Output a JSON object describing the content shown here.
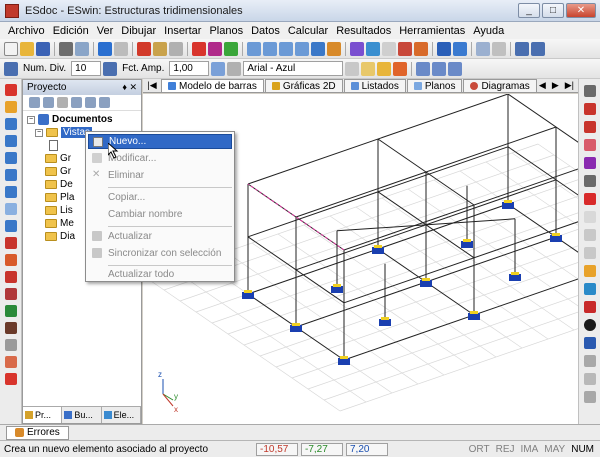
{
  "window": {
    "title": "ESdoc - ESwin: Estructuras tridimensionales",
    "minimize": "_",
    "maximize": "□",
    "close": "✕"
  },
  "menu": [
    "Archivo",
    "Edición",
    "Ver",
    "Dibujar",
    "Insertar",
    "Planos",
    "Datos",
    "Calcular",
    "Resultados",
    "Herramientas",
    "Ayuda"
  ],
  "toolbar2": {
    "div_label": "Num. Div.",
    "div_value": "10",
    "amp_label": "Fct. Amp.",
    "amp_value": "1,00",
    "font_value": "Arial - Azul"
  },
  "panel": {
    "title": "Proyecto",
    "pin": "♦ ✕",
    "root": "Documentos",
    "selected": "Vistas",
    "folders": [
      "Gr",
      "Gr",
      "De",
      "Pla",
      "Lis",
      "Me",
      "Dia"
    ],
    "tabs": [
      "Pr...",
      "Bu...",
      "Ele..."
    ]
  },
  "view_tabs": [
    {
      "label": "Modelo de barras",
      "color": "#3f7fd8"
    },
    {
      "label": "Gráficas 2D",
      "color": "#d9a21b"
    },
    {
      "label": "Listados",
      "color": "#5b8fd8"
    },
    {
      "label": "Planos",
      "color": "#7aa7e0"
    },
    {
      "label": "Diagramas",
      "color": "#c84a3a"
    }
  ],
  "view_nav": [
    "◀",
    "▶",
    "▶|"
  ],
  "context_menu": {
    "items": [
      "Nuevo...",
      "Modificar...",
      "Eliminar",
      "Copiar...",
      "Cambiar nombre",
      "Actualizar",
      "Sincronizar con selección",
      "Actualizar todo"
    ],
    "highlighted": "Nuevo..."
  },
  "axes": {
    "z": "z",
    "y": "y",
    "x": "x"
  },
  "bottom_tab": "Errores",
  "status": {
    "message": "Crea un nuevo elemento asociado al proyecto",
    "x": "-10,57",
    "y": "-7,27",
    "z": "7,20",
    "indicators": [
      "ORT",
      "REJ",
      "IMA",
      "MAY",
      "NUM"
    ],
    "x_color": "#c0392b",
    "y_color": "#2a8a2a",
    "z_color": "#1a4fb0"
  }
}
